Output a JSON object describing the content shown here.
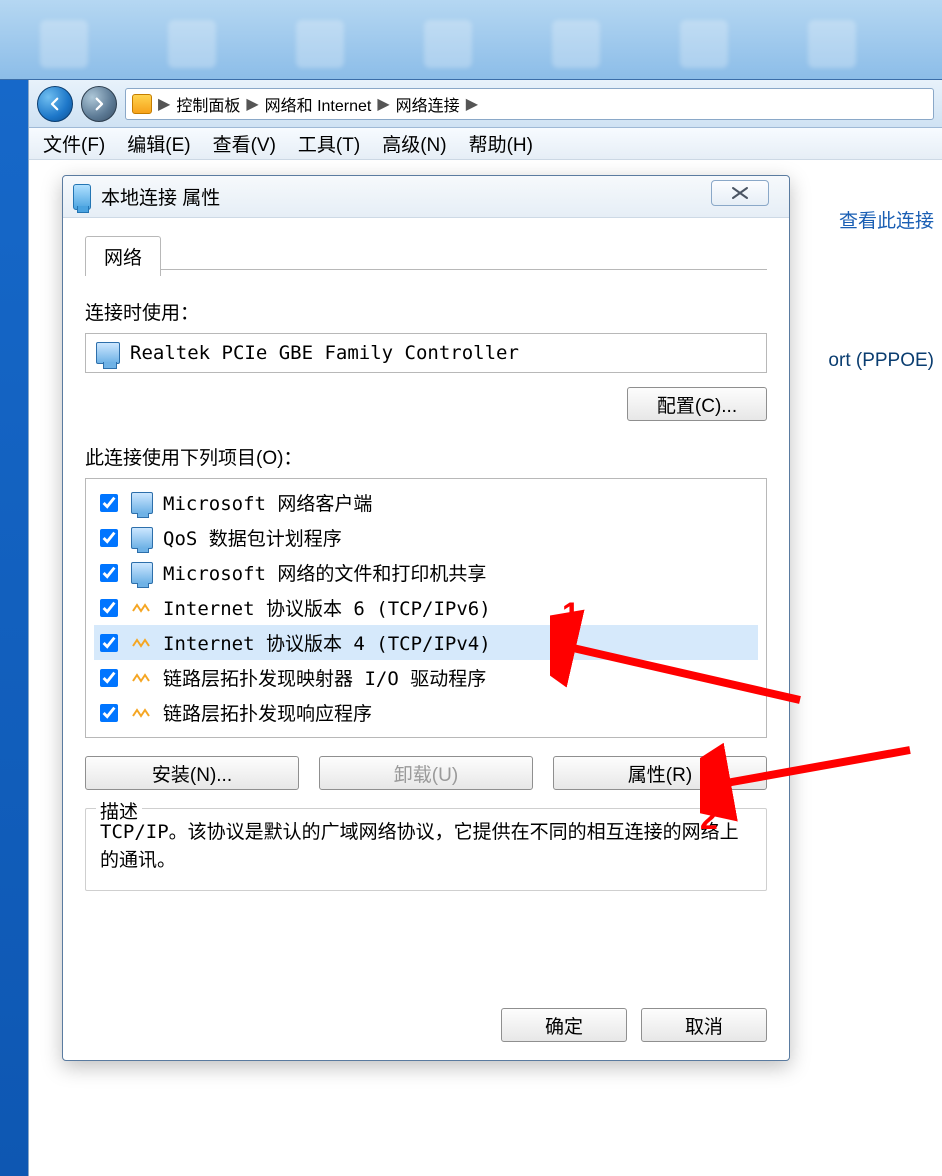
{
  "breadcrumbs": {
    "items": [
      "控制面板",
      "网络和 Internet",
      "网络连接"
    ]
  },
  "menubar": {
    "file": "文件(F)",
    "edit": "编辑(E)",
    "view": "查看(V)",
    "tools": "工具(T)",
    "adv": "高级(N)",
    "help": "帮助(H)"
  },
  "explorer": {
    "view_this_connection": "查看此连接",
    "pppoe_hint": "ort (PPPOE)"
  },
  "dialog": {
    "title": "本地连接 属性",
    "tab_network": "网络",
    "connect_using_label": "连接时使用：",
    "adapter": "Realtek PCIe GBE Family Controller",
    "configure_btn": "配置(C)...",
    "items_label": "此连接使用下列项目(O)：",
    "items": [
      {
        "label": "Microsoft 网络客户端",
        "checked": true,
        "icon": "pc"
      },
      {
        "label": "QoS 数据包计划程序",
        "checked": true,
        "icon": "pc"
      },
      {
        "label": "Microsoft 网络的文件和打印机共享",
        "checked": true,
        "icon": "pc"
      },
      {
        "label": "Internet 协议版本 6 (TCP/IPv6)",
        "checked": true,
        "icon": "proto"
      },
      {
        "label": "Internet 协议版本 4 (TCP/IPv4)",
        "checked": true,
        "icon": "proto",
        "selected": true
      },
      {
        "label": "链路层拓扑发现映射器 I/O 驱动程序",
        "checked": true,
        "icon": "proto"
      },
      {
        "label": "链路层拓扑发现响应程序",
        "checked": true,
        "icon": "proto"
      }
    ],
    "install_btn": "安装(N)...",
    "uninstall_btn": "卸载(U)",
    "properties_btn": "属性(R)",
    "desc_group_label": "描述",
    "desc_text": "TCP/IP。该协议是默认的广域网络协议，它提供在不同的相互连接的网络上的通讯。",
    "ok_btn": "确定",
    "cancel_btn": "取消"
  },
  "annotations": {
    "one": "1",
    "two": "2"
  }
}
